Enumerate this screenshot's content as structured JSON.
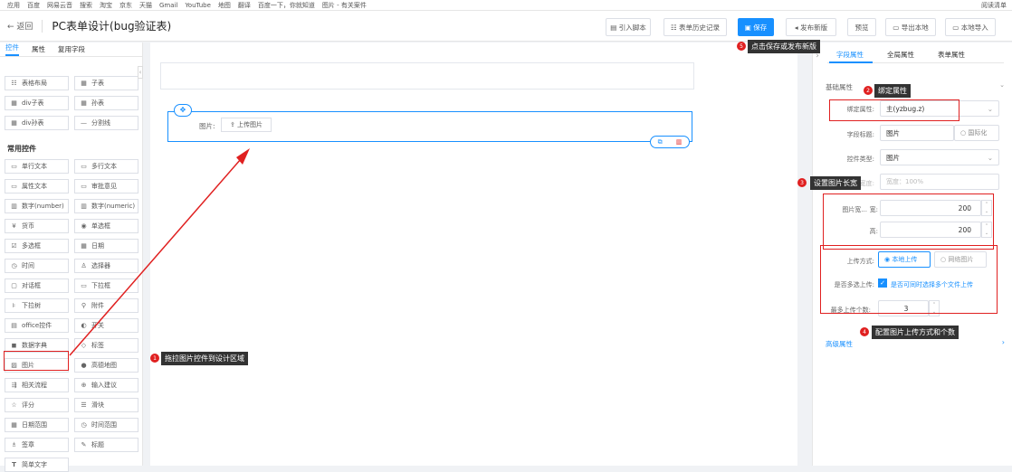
{
  "bookmarks": [
    "应用",
    "百度",
    "网易云音",
    "搜索",
    "淘宝",
    "京东",
    "天猫",
    "Gmail",
    "YouTube",
    "地图",
    "翻译",
    "百度一下，你就知道",
    "图片 - 有关案件"
  ],
  "bookmarks_right": "阅读清单",
  "header": {
    "back": "返回",
    "title": "PC表单设计(bug验证表)"
  },
  "toolbar": {
    "import": "引入脚本",
    "history": "表单历史记录",
    "save": "保存",
    "publish": "发布新版",
    "preview": "预览",
    "export": "导出本地",
    "import_local": "本地导入"
  },
  "left": {
    "tabs": [
      "控件",
      "属性",
      "复用字段"
    ],
    "layout_items": [
      "表格布局",
      "子表",
      "div子表",
      "孙表",
      "div孙表",
      "分割线"
    ],
    "common_title": "常用控件",
    "items": [
      "单行文本",
      "多行文本",
      "属性文本",
      "审批意见",
      "数字(number)",
      "数字(numeric)",
      "货币",
      "单选框",
      "多选框",
      "日期",
      "时间",
      "选择器",
      "对话框",
      "下拉框",
      "下拉树",
      "附件",
      "office控件",
      "开关",
      "数据字典",
      "标签",
      "图片",
      "高德地图",
      "相关流程",
      "输入建议",
      "评分",
      "滑块",
      "日期范围",
      "时间范围",
      "签章",
      "标题",
      "简单文字"
    ]
  },
  "canvas": {
    "field_label": "图片:",
    "upload_button": "上传图片"
  },
  "right": {
    "tabs": [
      "字段属性",
      "全局属性",
      "表单属性"
    ],
    "basic_section": "基础属性",
    "bind_label": "绑定属性:",
    "bind_value": "主(yzbug.z)",
    "field_title_label": "字段标题:",
    "field_title_value": "图片",
    "i18n": "国际化",
    "control_type_label": "控件类型:",
    "control_type_value": "图片",
    "width_label": "宽度:",
    "width_placeholder": "宽度：100%",
    "size_label": "图片宽...",
    "width_sub": "宽:",
    "width_value": "200",
    "height_sub": "高:",
    "height_value": "200",
    "upload_mode_label": "上传方式:",
    "upload_local": "本地上传",
    "upload_net": "网络图片",
    "multi_label": "是否多选上传:",
    "multi_text": "是否可同时选择多个文件上传",
    "max_label": "最多上传个数:",
    "max_value": "3",
    "advanced_section": "高级属性"
  },
  "annotations": {
    "a1": "拖拉图片控件到设计区域",
    "a2": "绑定属性",
    "a3": "设置图片长宽",
    "a4": "配置图片上传方式和个数",
    "a5": "点击保存或发布新版",
    "n1": "1",
    "n2": "2",
    "n3": "3",
    "n4": "4",
    "n5": "5"
  },
  "colors": {
    "primary": "#1890ff",
    "annotation_red": "#e02020"
  }
}
